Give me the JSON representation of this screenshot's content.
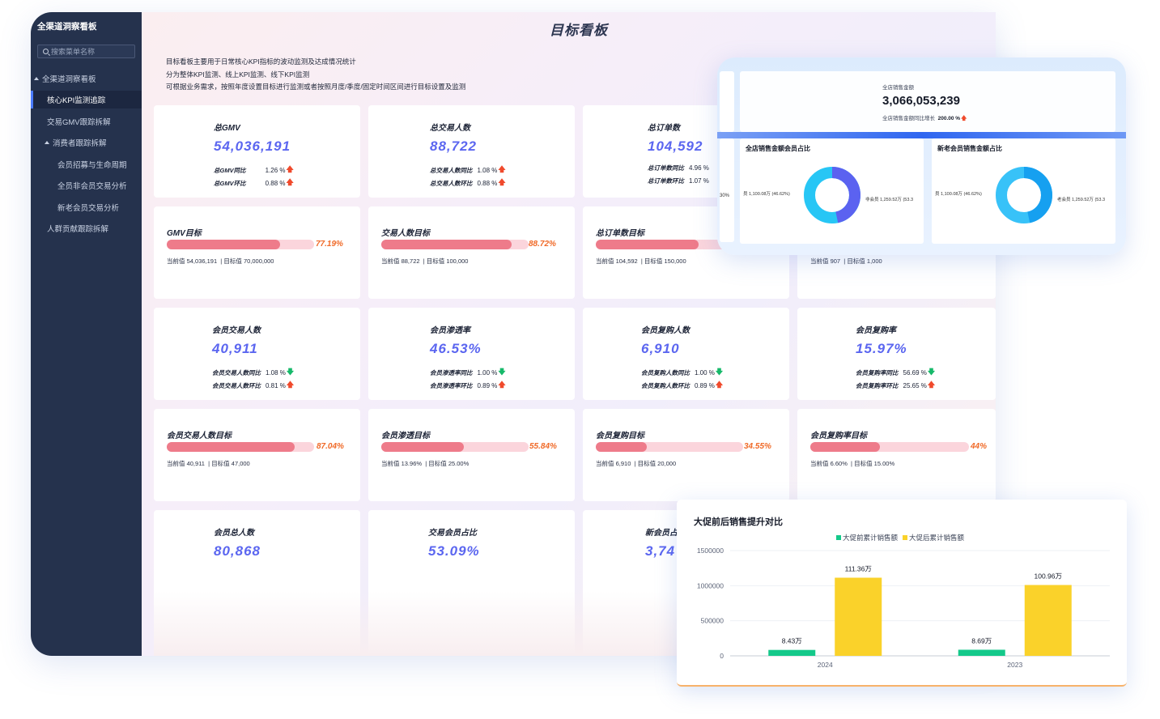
{
  "sidebar": {
    "title": "全渠道洞察看板",
    "search_placeholder": "搜索菜单名称",
    "items": [
      {
        "label": "全渠道洞察看板"
      },
      {
        "label": "核心KPI监测追踪"
      },
      {
        "label": "交易GMV跟踪拆解"
      },
      {
        "label": "消费者跟踪拆解"
      },
      {
        "label": "会员招募与生命周期"
      },
      {
        "label": "全员非会员交易分析"
      },
      {
        "label": "新老会员交易分析"
      },
      {
        "label": "人群贡献跟踪拆解"
      }
    ]
  },
  "page": {
    "title": "目标看板",
    "desc": [
      "目标看板主要用于日常核心KPI指标的波动监测及达成情况统计",
      "分为整体KPI监测、线上KPI监测、线下KPI监测",
      "可根据业务需求，按照年度设置目标进行监测或者按照月度/季度/固定时间区间进行目标设置及监测"
    ]
  },
  "kpi_row1": [
    {
      "name": "总GMV",
      "value": "54,036,191",
      "l1": "总GMV同比",
      "v1": "1.26 %",
      "d1": "up",
      "l2": "总GMV环比",
      "v2": "0.88 %",
      "d2": "up"
    },
    {
      "name": "总交易人数",
      "value": "88,722",
      "l1": "总交易人数同比",
      "v1": "1.08 %",
      "d1": "up",
      "l2": "总交易人数环比",
      "v2": "0.88 %",
      "d2": "up"
    },
    {
      "name": "总订单数",
      "value": "104,592",
      "l1": "总订单数同比",
      "v1": "4.96 %",
      "d1": "",
      "l2": "总订单数环比",
      "v2": "1.07 %",
      "d2": ""
    }
  ],
  "target_row1": [
    {
      "name": "GMV目标",
      "pct": "77.19%",
      "fill": 0.7719,
      "cur_label": "当前值",
      "cur": "54,036,191",
      "tgt_label": "目标值",
      "tgt": "70,000,000"
    },
    {
      "name": "交易人数目标",
      "pct": "88.72%",
      "fill": 0.8872,
      "cur_label": "当前值",
      "cur": "88,722",
      "tgt_label": "目标值",
      "tgt": "100,000"
    },
    {
      "name": "总订单数目标",
      "pct": "",
      "fill": 0.7,
      "cur_label": "当前值",
      "cur": "104,592",
      "tgt_label": "目标值",
      "tgt": "150,000"
    },
    {
      "name": "",
      "pct": "",
      "fill": 0,
      "cur_label": "当前值",
      "cur": "907",
      "tgt_label": "目标值",
      "tgt": "1,000"
    }
  ],
  "kpi_row2": [
    {
      "name": "会员交易人数",
      "value": "40,911",
      "l1": "会员交易人数同比",
      "v1": "1.08 %",
      "d1": "down",
      "l2": "会员交易人数环比",
      "v2": "0.81 %",
      "d2": "up"
    },
    {
      "name": "会员渗透率",
      "value": "46.53%",
      "l1": "会员渗透率同比",
      "v1": "1.00 %",
      "d1": "down",
      "l2": "会员渗透率环比",
      "v2": "0.89 %",
      "d2": "up"
    },
    {
      "name": "会员复购人数",
      "value": "6,910",
      "l1": "会员复购人数同比",
      "v1": "1.00 %",
      "d1": "down",
      "l2": "会员复购人数环比",
      "v2": "0.89 %",
      "d2": "up"
    },
    {
      "name": "会员复购率",
      "value": "15.97%",
      "l1": "会员复购率同比",
      "v1": "56.69 %",
      "d1": "down",
      "l2": "会员复购率环比",
      "v2": "25.65 %",
      "d2": "up"
    }
  ],
  "target_row2": [
    {
      "name": "会员交易人数目标",
      "pct": "87.04%",
      "fill": 0.8704,
      "cur_label": "当前值",
      "cur": "40,911",
      "tgt_label": "目标值",
      "tgt": "47,000"
    },
    {
      "name": "会员渗透目标",
      "pct": "55.84%",
      "fill": 0.5584,
      "cur_label": "当前值",
      "cur": "13.96%",
      "tgt_label": "目标值",
      "tgt": "25.00%"
    },
    {
      "name": "会员复购目标",
      "pct": "34.55%",
      "fill": 0.3455,
      "cur_label": "当前值",
      "cur": "6,910",
      "tgt_label": "目标值",
      "tgt": "20,000"
    },
    {
      "name": "会员复购率目标",
      "pct": "44%",
      "fill": 0.44,
      "cur_label": "当前值",
      "cur": "6.60%",
      "tgt_label": "目标值",
      "tgt": "15.00%"
    }
  ],
  "kpi_row3": [
    {
      "name": "会员总人数",
      "value": "80,868"
    },
    {
      "name": "交易会员占比",
      "value": "53.09%"
    },
    {
      "name": "新会员占",
      "value": "3,74"
    }
  ],
  "overlay_top": {
    "total_label": "全店销售金额",
    "total_value": "3,066,053,239",
    "growth_label": "全店销售金额同比增长",
    "growth_value": "200.00 %",
    "left_fragment": "30%",
    "donut1": {
      "title": "全店销售金额会员占比",
      "left_label": "员 1,100.08万 (46.62%)",
      "right_label": "非会员 1,259.52万 (53.3",
      "share": 0.4662,
      "colors": [
        "#5b62f0",
        "#27c6f5"
      ]
    },
    "donut2": {
      "title": "新老会员销售金额占比",
      "left_label": "员 1,100.08万 (46.62%)",
      "right_label": "老会员 1,259.52万 (53.3",
      "share": 0.4662,
      "colors": [
        "#16a0f0",
        "#38c2f8"
      ]
    }
  },
  "colors": {
    "accent": "#5b66f0",
    "bar_fill": "#ee7b8a",
    "bar_bg": "#fbd5dc",
    "pct": "#f06a28",
    "up": "#f04a2c",
    "down": "#16b96a",
    "series_before": "#14c98a",
    "series_after": "#fad22a"
  },
  "chart_data": {
    "type": "bar",
    "title": "大促前后销售提升对比",
    "categories": [
      "2024",
      "2023"
    ],
    "series": [
      {
        "name": "大促前累计销售额",
        "values": [
          84300,
          86900
        ],
        "labels": [
          "8.43万",
          "8.69万"
        ],
        "color": "#14c98a"
      },
      {
        "name": "大促后累计销售额",
        "values": [
          1113600,
          1009600
        ],
        "labels": [
          "111.36万",
          "100.96万"
        ],
        "color": "#fad22a"
      }
    ],
    "yticks": [
      "0",
      "500000",
      "1000000",
      "1500000"
    ],
    "ylim": [
      0,
      1500000
    ],
    "legend": "top-center",
    "grid": true
  }
}
